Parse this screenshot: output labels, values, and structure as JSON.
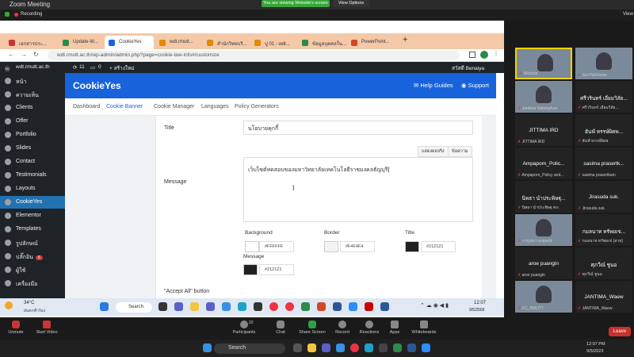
{
  "zoom": {
    "window_title": "Zoom Meeting",
    "recording": "Recording",
    "sharing_banner": "You are viewing Website's screen",
    "view_options": "View Options",
    "view": "View"
  },
  "browser": {
    "tabs": [
      "เอกสารประ...",
      "Update-W...",
      "CookieYes",
      "wdt.rmutt...",
      "สำนักวิทยบริ...",
      "ปู 01 - wdt...",
      "ข้อมูลบุคคลใน...",
      "PowerPoint..."
    ],
    "url": "wdt.rmutt.ac.th/wp-admin/admin.php?page=cookie-law-info#/customize"
  },
  "wp_admin_bar": {
    "site": "wdt.rmutt.ac.th",
    "updates": "11",
    "comments": "0",
    "new": "+ สร้างใหม่",
    "user": "สวัสดี Benaiya"
  },
  "wp_sidebar": [
    {
      "label": "หน้า"
    },
    {
      "label": "ความเห็น"
    },
    {
      "label": "Clients"
    },
    {
      "label": "Offer"
    },
    {
      "label": "Portfolio"
    },
    {
      "label": "Slides"
    },
    {
      "label": "Contact"
    },
    {
      "label": "Testimonials"
    },
    {
      "label": "Layouts"
    },
    {
      "label": "CookieYes"
    },
    {
      "label": "Elementor"
    },
    {
      "label": "Templates"
    },
    {
      "label": "รูปลักษณ์"
    },
    {
      "label": "ปลั๊กอิน",
      "badge": "6"
    },
    {
      "label": "ผู้ใช้"
    },
    {
      "label": "เครื่องมือ"
    }
  ],
  "cookieyes": {
    "logo": "CookieYes",
    "help": "Help Guides",
    "support": "Support",
    "nav": [
      "Dashboard",
      "Cookie Banner",
      "Cookie Manager",
      "Languages",
      "Policy Generators"
    ],
    "title_label": "Title",
    "title_value": "นโยบายคุกกี้",
    "message_label": "Message",
    "message_value": "เว็บไซต์ทดสอบของมหาวิทยาลัยเทคโนโลยีราชมงคลธัญบุรี",
    "editor_tabs": [
      "แสดงผลจริง",
      "ข้อความ"
    ],
    "colors": {
      "background_label": "Background",
      "background_value": "#FFFFFF",
      "border_label": "Border",
      "border_value": "#F4F4F4",
      "title_label": "Title",
      "title_value": "#212121",
      "message_label": "Message",
      "message_value": "#212121"
    },
    "accept_all_label": "\"Accept All\" button"
  },
  "taskbar_top": {
    "weather_temp": "34°C",
    "weather_text": "ฝนตกฟ้าร้อง",
    "search": "Search",
    "time": "12:07",
    "date": "9/5/2566"
  },
  "gallery": [
    {
      "name": "",
      "sub": "Website",
      "photo": true
    },
    {
      "name": "",
      "sub": "Sui Patcharee",
      "photo": true
    },
    {
      "name": "",
      "sub": "Jantima Taibenphon",
      "photo": true
    },
    {
      "name": "ศรีวรินทร์ เอี่ยมวิลัย...",
      "sub": "ศรีวรินทร์ เอี่ยมวิลัย..."
    },
    {
      "name": "JITTIMA IRD",
      "sub": "JITTIMA IRD"
    },
    {
      "name": "ฮันฟ์ หรรษ์ผิดพ...",
      "sub": "ฮันฟ์ หรรษ์ผิดพ"
    },
    {
      "name": "Ampaporn_Polic...",
      "sub": "Ampaporn_Policy and..."
    },
    {
      "name": "sasima prasertk...",
      "sub": "sasima prasertkam"
    },
    {
      "name": "นิพธา นำประพิษฐุ...",
      "sub": "นิพธา นำประพิษฐุ ศภ."
    },
    {
      "name": "Jirasuda suk.",
      "sub": "Jirasuda suk."
    },
    {
      "name": "",
      "sub": "กาญจนา ผงยุพงษ์",
      "photo": true
    },
    {
      "name": "กมลนาท ทรัพยเข...",
      "sub": "กมลนาท ทรัพยเข่ (สวช)"
    },
    {
      "name": "aroe puangin",
      "sub": "aroe puangin"
    },
    {
      "name": "ศุภวีณ์ ชูนอ",
      "sub": "ศุภวีณ์ ชูนอ"
    },
    {
      "name": "",
      "sub": "KC_RMUTT",
      "photo": true
    },
    {
      "name": "JANTIMA_Waew",
      "sub": "JANTIMA_Waew"
    }
  ],
  "zoom_toolbar": {
    "unmute": "Unmute",
    "start_video": "Start Video",
    "participants": "Participants",
    "participants_count": "20",
    "chat": "Chat",
    "share_screen": "Share Screen",
    "record": "Record",
    "reactions": "Reactions",
    "apps": "Apps",
    "whiteboards": "Whiteboards",
    "leave": "Leave"
  },
  "taskbar_bottom": {
    "search": "Search",
    "time": "12:07 PM",
    "date": "9/5/2023"
  }
}
